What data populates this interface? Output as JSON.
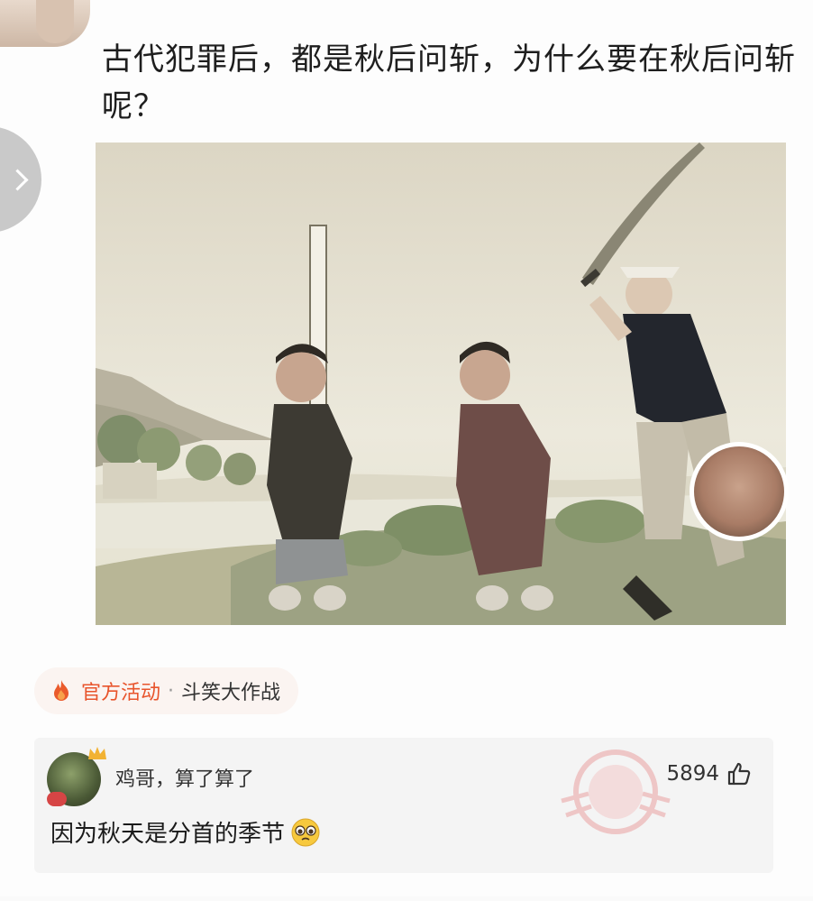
{
  "post": {
    "title": "古代犯罪后，都是秋后问斩，为什么要在秋后问斩呢？"
  },
  "activity": {
    "tag": "官方活动",
    "separator": "·",
    "name": "斗笑大作战",
    "accent_color": "#e8542c"
  },
  "comment": {
    "user": "鸡哥，算了算了",
    "text": "因为秋天是分首的季节",
    "likes": "5894",
    "stamp_icon": "hot-comment-stamp-icon"
  },
  "colors": {
    "accent": "#e8542c",
    "card_bg": "#f4f4f4"
  }
}
